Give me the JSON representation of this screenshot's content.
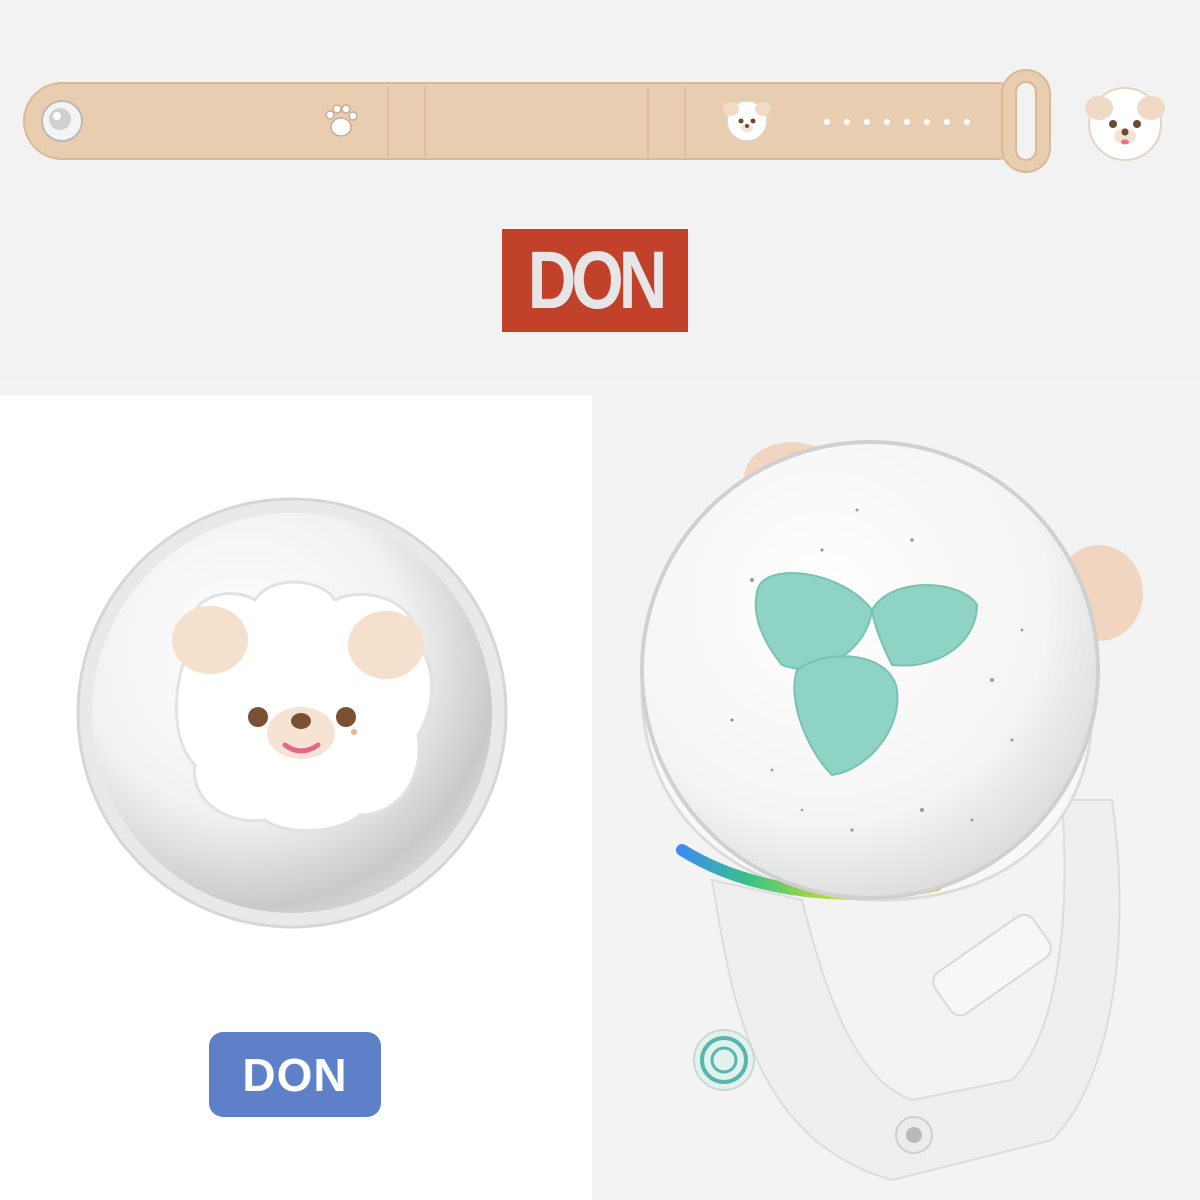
{
  "labels": {
    "top_name": "DON",
    "bottom_name": "DON"
  },
  "icons": {
    "strap": "silicone-wristband",
    "paw": "paw-icon",
    "puppy_face": "puppy-face-icon",
    "charm": "puppy-charm",
    "lightstick_watch": "snow-globe-watch"
  },
  "colors": {
    "strap": "#e8cdb0",
    "label_red": "#c2412b",
    "label_blue": "#5d80c9",
    "ear": "#f2dcc8",
    "mint": "#8fd3c4"
  }
}
